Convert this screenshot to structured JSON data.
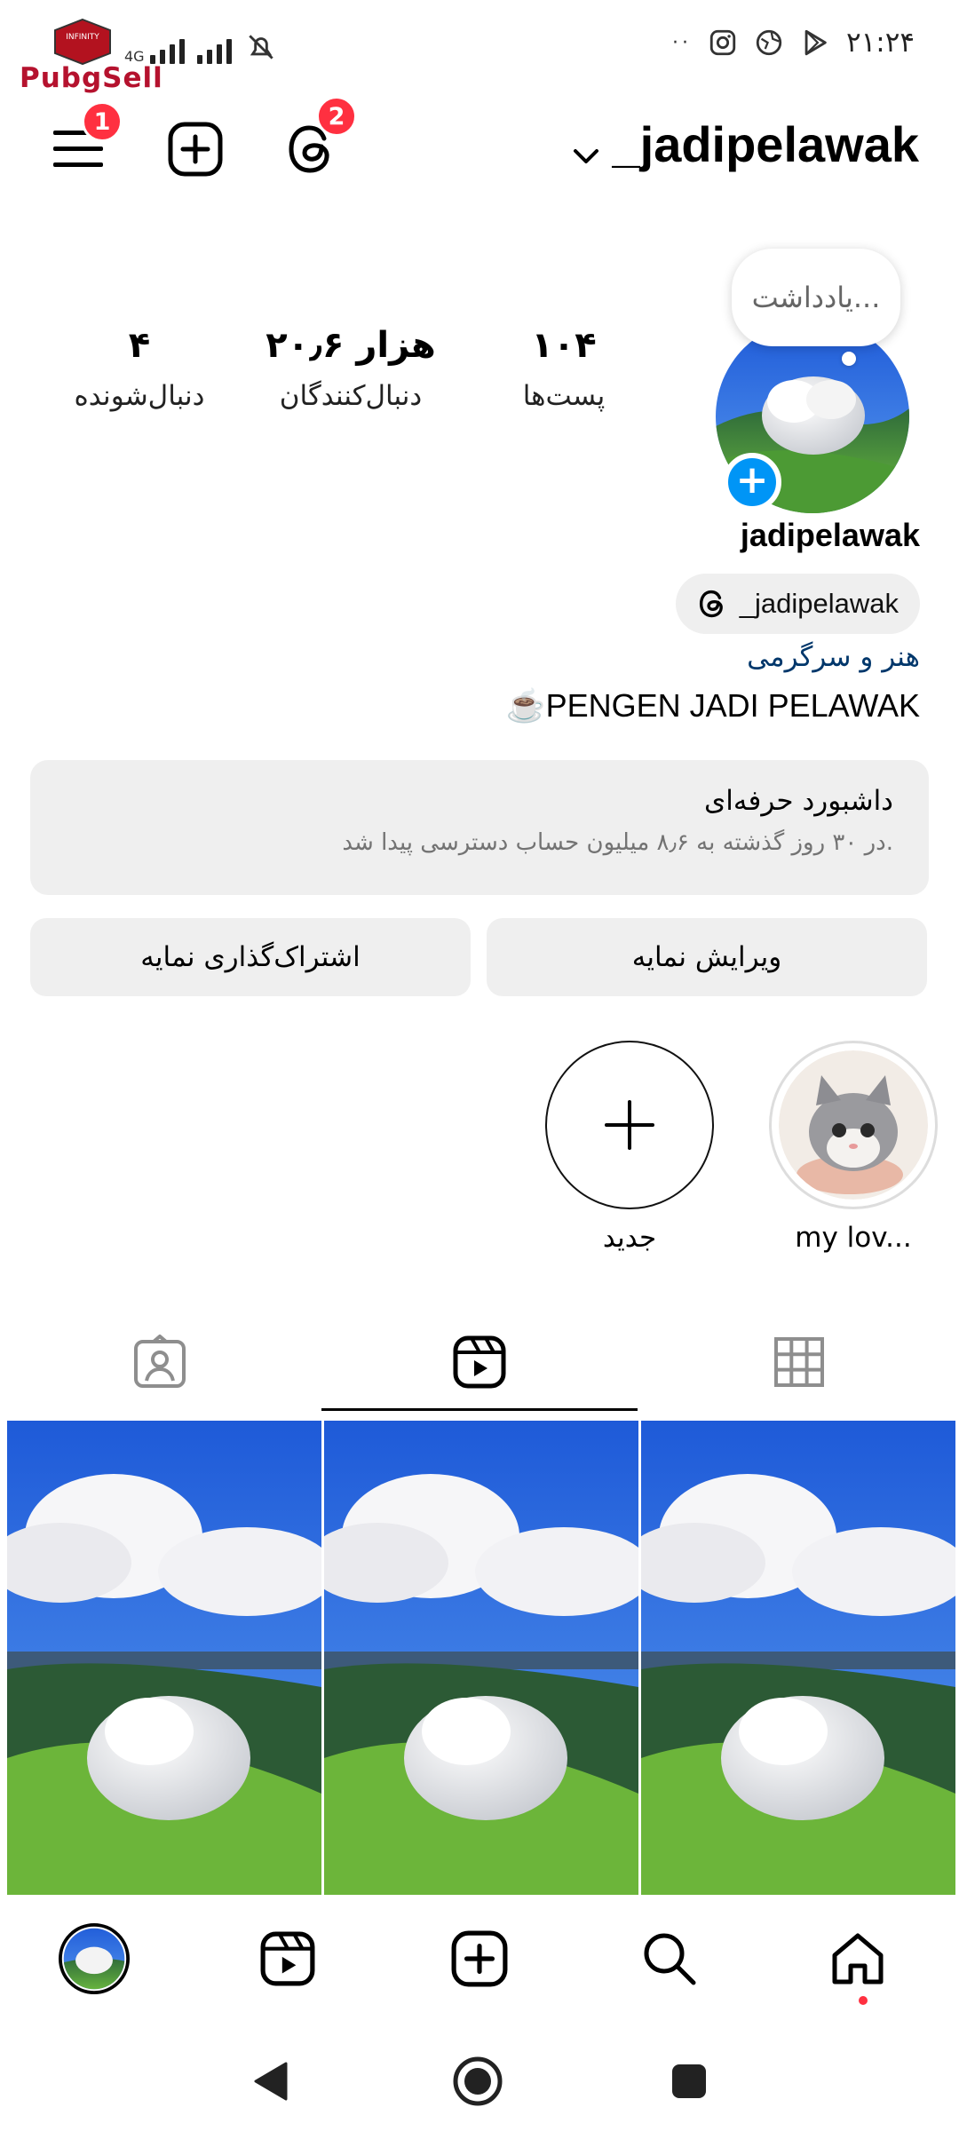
{
  "status_bar": {
    "watermark": "PubgSell",
    "watermark_badge": "INFINITY",
    "network": "4G",
    "time": "۲۱:۲۴",
    "icons": [
      "signal-icon",
      "mute-bell-icon",
      "instagram-icon",
      "vpn-icon",
      "play-store-icon"
    ]
  },
  "top_bar": {
    "username": "_jadipelawak",
    "menu_badge": "1",
    "threads_badge": "2",
    "icons": [
      "menu-icon",
      "create-icon",
      "threads-icon",
      "chevron-down-icon"
    ]
  },
  "profile": {
    "note_placeholder": "یادداشت...",
    "stats": {
      "posts": {
        "value": "۱۰۴",
        "label": "پست‌ها"
      },
      "followers": {
        "value": "۲۰٫۶ هزار",
        "label": "دنبال‌کنندگان"
      },
      "following": {
        "value": "۴",
        "label": "دنبال‌شونده"
      }
    },
    "display_name": "jadipelawak",
    "threads_handle": "_jadipelawak",
    "category": "هنر و سرگرمی",
    "bio": "PENGEN JADI PELAWAK",
    "bio_emoji": "☕"
  },
  "dashboard": {
    "title": "داشبورد حرفه‌ای",
    "subtitle": "در ۳۰ روز گذشته به ۸٫۶ میلیون حساب دسترسی پیدا شد."
  },
  "actions": {
    "edit_profile": "ویرایش نمایه",
    "share_profile": "اشتراک‌گذاری نمایه"
  },
  "highlights": [
    {
      "label": "my lov..."
    },
    {
      "label": "جدید"
    }
  ],
  "tabs": [
    "grid-icon",
    "reels-icon",
    "tagged-icon"
  ],
  "active_tab": "reels",
  "bottom_nav": [
    "home-icon",
    "search-icon",
    "create-icon",
    "reels-icon",
    "profile-avatar"
  ],
  "colors": {
    "accent_blue": "#0095f6",
    "badge_red": "#ff3040",
    "card_gray": "#efefef",
    "category_blue": "#00376b"
  }
}
